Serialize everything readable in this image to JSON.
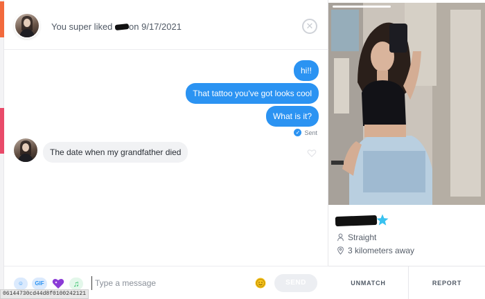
{
  "header": {
    "text_before": "You super liked",
    "text_after": "on 9/17/2021",
    "close_glyph": "✕"
  },
  "messages": {
    "outgoing": [
      "hi!!",
      "That tattoo you've got looks cool",
      "What is it?"
    ],
    "sent_status": "Sent",
    "incoming": [
      "The date when my grandfather died"
    ]
  },
  "composer": {
    "sticker_label": "☺",
    "gif_label": "GIF",
    "music_glyph": "♫",
    "placeholder": "Type a message",
    "send_label": "SEND"
  },
  "profile": {
    "orientation": "Straight",
    "distance": "3 kilometers away",
    "unmatch_label": "UNMATCH",
    "report_label": "REPORT"
  },
  "footer_hash": "06144730cd44d8f0100242121",
  "colors": {
    "accent_blue": "#2b93f2",
    "super_like_star": "#39c2f0",
    "edge_orange": "#f26a3d",
    "edge_pink": "#e94b6a"
  }
}
